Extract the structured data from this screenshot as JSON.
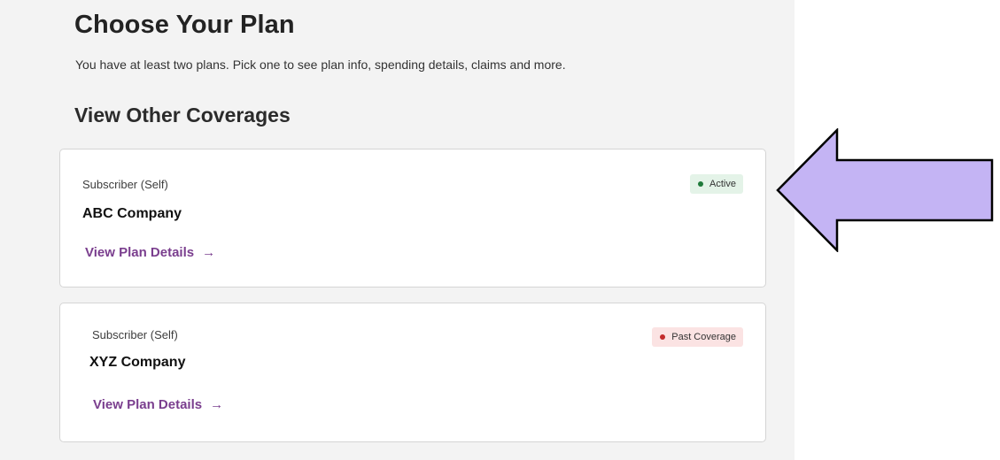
{
  "header": {
    "title": "Choose Your Plan",
    "subtitle": "You have at least two plans. Pick one to see plan info, spending details, claims and more."
  },
  "section": {
    "title": "View Other Coverages"
  },
  "plans": [
    {
      "role": "Subscriber (Self)",
      "company": "ABC Company",
      "link_label": "View Plan Details",
      "link_arrow": "→",
      "status": "Active",
      "status_bg": "#e4f3e8",
      "status_dot": "#1f7a3a"
    },
    {
      "role": "Subscriber (Self)",
      "company": "XYZ Company",
      "link_label": "View Plan Details",
      "link_arrow": "→",
      "status": "Past Coverage",
      "status_bg": "#fbe3e3",
      "status_dot": "#c32b2b"
    }
  ],
  "annotation": {
    "icon": "left-arrow-callout-icon",
    "fill": "#c4b4f4",
    "stroke": "#000000"
  }
}
